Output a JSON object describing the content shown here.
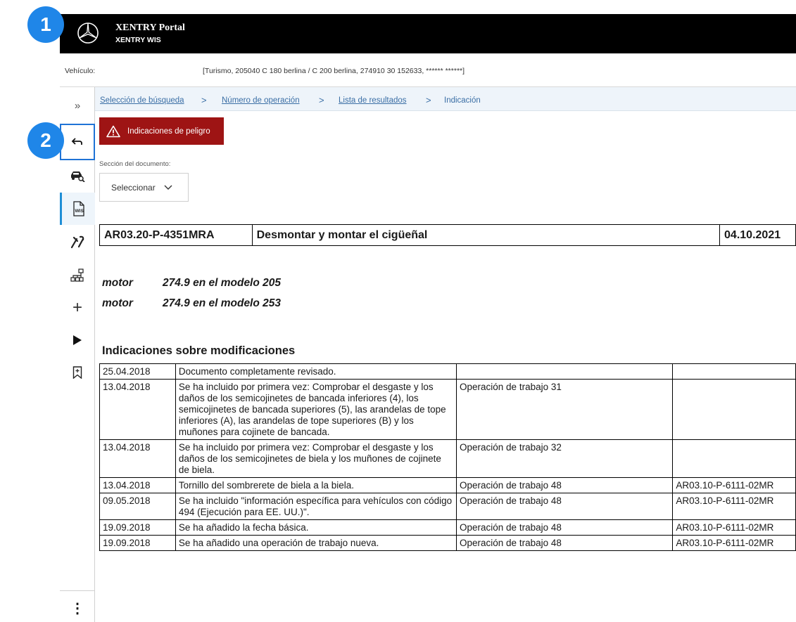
{
  "header": {
    "title": "XENTRY Portal",
    "subtitle": "XENTRY WIS",
    "logo": "mercedes-star-icon"
  },
  "vehicle": {
    "label": "Vehículo:",
    "value": "[Turismo, 205040 C 180 berlina / C 200 berlina, 274910 30 152633, ****** ******]"
  },
  "breadcrumb": {
    "items": [
      "Selección de búsqueda",
      "Número de operación",
      "Lista de resultados"
    ],
    "current": "Indicación",
    "separator": ">"
  },
  "sidebar": {
    "items": [
      {
        "icon": "expand-chevrons-icon",
        "glyph": "»"
      },
      {
        "icon": "back-arrow-icon"
      },
      {
        "icon": "car-search-icon"
      },
      {
        "icon": "wis-document-icon"
      },
      {
        "icon": "tools-icon"
      },
      {
        "icon": "tree-structure-icon"
      },
      {
        "icon": "plus-icon",
        "glyph": "+"
      },
      {
        "icon": "play-icon"
      },
      {
        "icon": "bookmark-icon"
      },
      {
        "icon": "more-vertical-icon",
        "glyph": "⋮"
      }
    ]
  },
  "hazard_button": {
    "label": "Indicaciones de peligro",
    "color": "#9e1414"
  },
  "document_section": {
    "label": "Sección del documento:",
    "select_value": "Seleccionar"
  },
  "document": {
    "id": "AR03.20-P-4351MRA",
    "title": "Desmontar y montar el cigüeñal",
    "date": "04.10.2021"
  },
  "engines": [
    {
      "label": "motor",
      "value": "274.9 en el modelo 205"
    },
    {
      "label": "motor",
      "value": "274.9 en el modelo 253"
    }
  ],
  "modifications": {
    "heading": "Indicaciones sobre modificaciones",
    "rows": [
      {
        "date": "25.04.2018",
        "text": "Documento completamente revisado.",
        "operation": "",
        "ref": ""
      },
      {
        "date": "13.04.2018",
        "text": "Se ha incluido por primera vez: Comprobar el desgaste y los daños de los semicojinetes de bancada inferiores (4), los semicojinetes de bancada superiores (5), las arandelas de tope inferiores (A), las arandelas de tope superiores (B) y los muñones para cojinete de bancada.",
        "operation": "Operación de trabajo 31",
        "ref": ""
      },
      {
        "date": "13.04.2018",
        "text": "Se ha incluido por primera vez: Comprobar el desgaste y los daños de los semicojinetes de biela y los muñones de cojinete de biela.",
        "operation": "Operación de trabajo 32",
        "ref": ""
      },
      {
        "date": "13.04.2018",
        "text": "Tornillo del sombrerete de biela a la biela.",
        "operation": "Operación de trabajo 48",
        "ref": "AR03.10-P-6111-02MR"
      },
      {
        "date": "09.05.2018",
        "text": "Se ha incluido \"información específica para vehículos con código 494 (Ejecución para EE. UU.)\".",
        "operation": "Operación de trabajo 48",
        "ref": "AR03.10-P-6111-02MR"
      },
      {
        "date": "19.09.2018",
        "text": "Se ha añadido la fecha básica.",
        "operation": "Operación de trabajo 48",
        "ref": "AR03.10-P-6111-02MR"
      },
      {
        "date": "19.09.2018",
        "text": "Se ha añadido una operación de trabajo nueva.",
        "operation": "Operación de trabajo 48",
        "ref": "AR03.10-P-6111-02MR"
      }
    ]
  },
  "annotations": {
    "badge_1": "1",
    "badge_2": "2",
    "color": "#1f86e8"
  }
}
